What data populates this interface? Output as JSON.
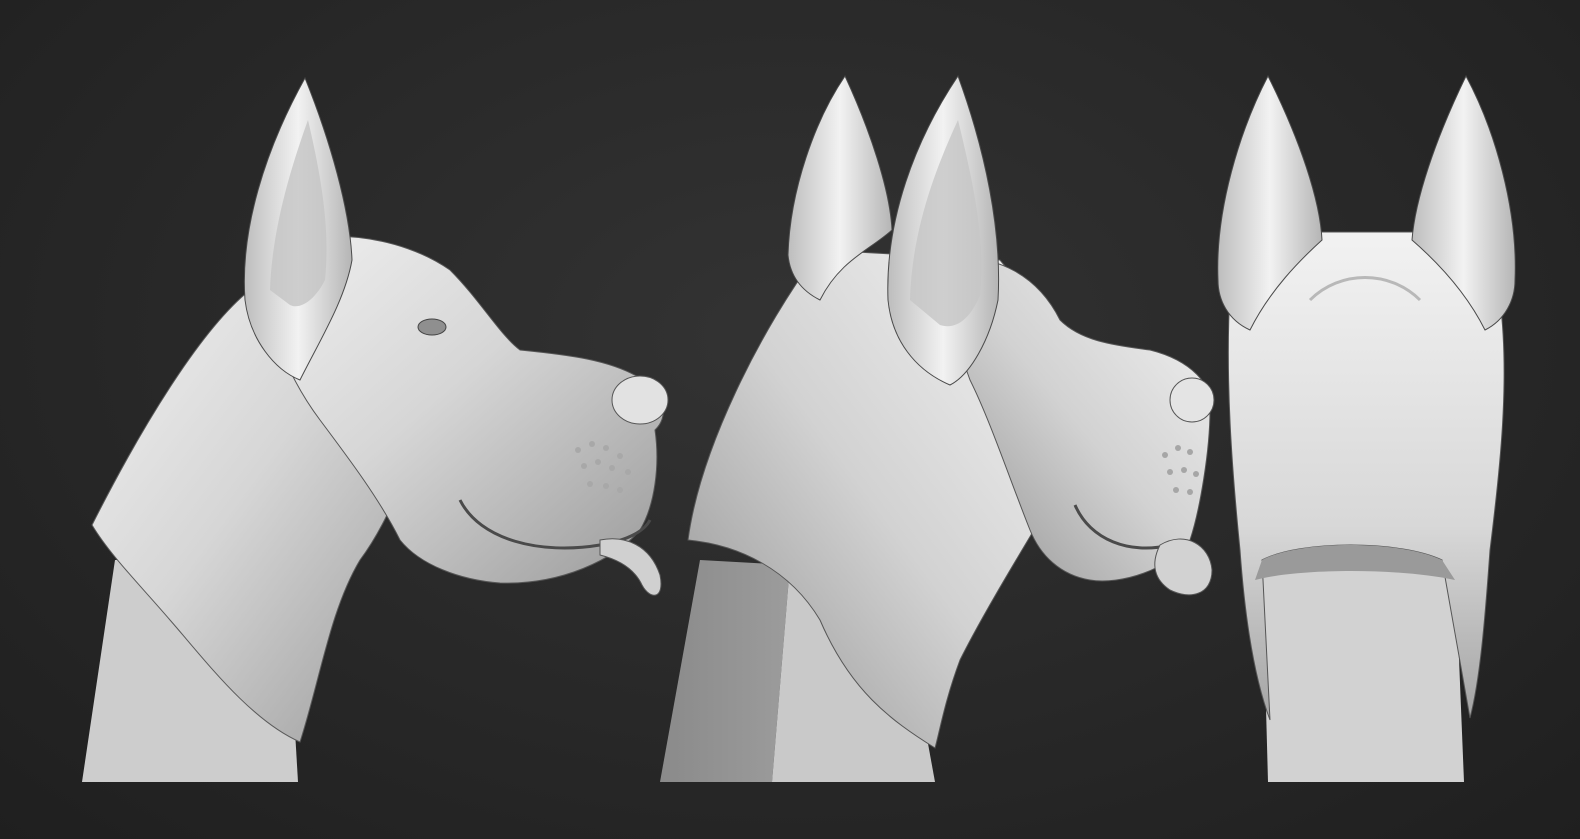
{
  "scene": {
    "background_color": "#262626",
    "clay_color": "#d8d8d8",
    "base_color": "#cfcfcf",
    "views": [
      {
        "name": "side-profile-view"
      },
      {
        "name": "three-quarter-view"
      },
      {
        "name": "back-view"
      }
    ]
  }
}
